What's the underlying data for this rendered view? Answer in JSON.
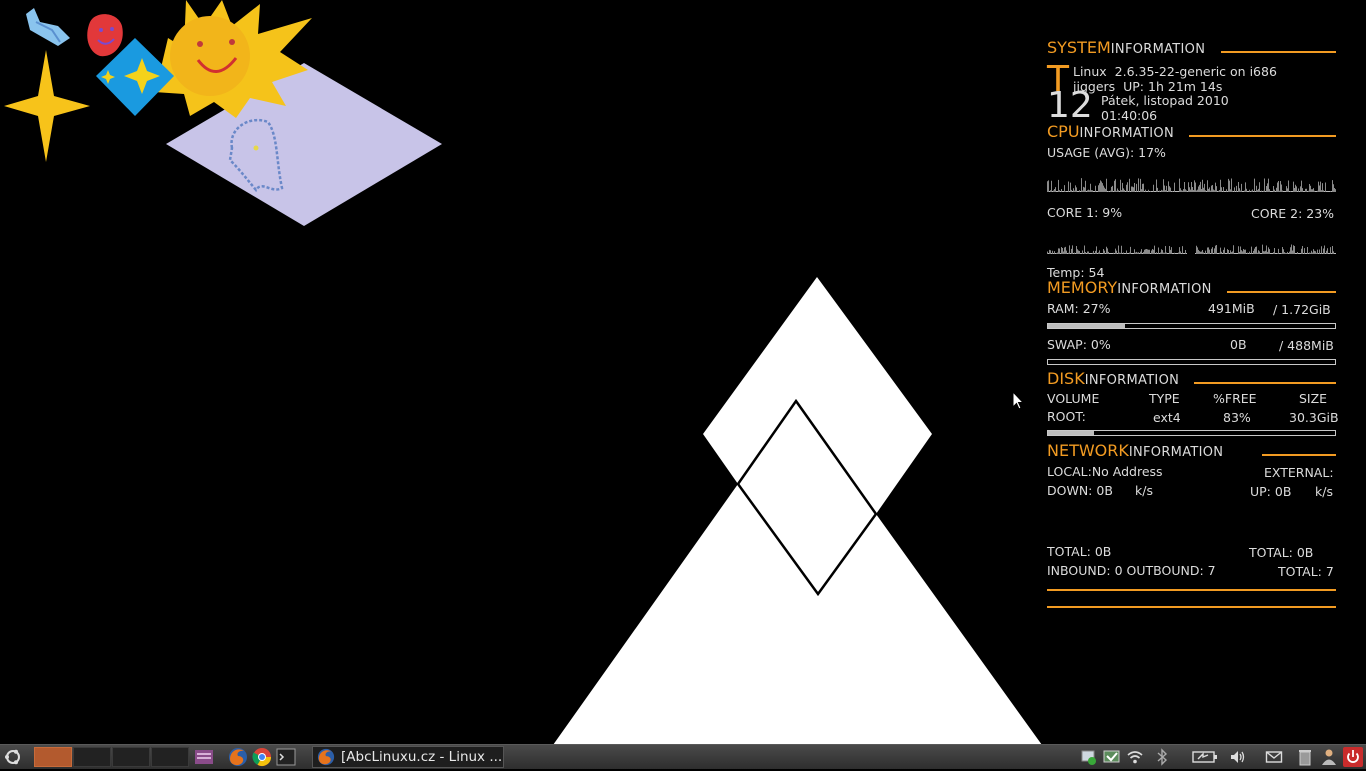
{
  "conky": {
    "system": {
      "title_big": "SYSTEM",
      "title_small": "INFORMATION",
      "letter": "T",
      "day": "12",
      "os": "Linux",
      "kernel": "2.6.35-22-generic on i686",
      "host": "jiggers",
      "uptime_label": "UP:",
      "uptime": "1h 21m 14s",
      "date": "Pátek, listopad 2010",
      "time": "01:40:06"
    },
    "cpu": {
      "title_big": "CPU",
      "title_small": "INFORMATION",
      "usage_label": "USAGE (AVG):",
      "usage": "17%",
      "core1_label": "CORE 1:",
      "core1": "9%",
      "core2_label": "CORE 2:",
      "core2": "23%",
      "temp_label": "Temp:",
      "temp": "54"
    },
    "memory": {
      "title_big": "MEMORY",
      "title_small": "INFORMATION",
      "ram_label": "RAM:",
      "ram_pct": "27%",
      "ram_used": "491MiB",
      "ram_total": "/ 1.72GiB",
      "ram_fraction": 0.27,
      "swap_label": "SWAP:",
      "swap_pct": "0%",
      "swap_used": "0B",
      "swap_total": "/ 488MiB",
      "swap_fraction": 0.0
    },
    "disk": {
      "title_big": "DISK",
      "title_small": "INFORMATION",
      "col_volume": "VOLUME",
      "col_type": "TYPE",
      "col_free": "%FREE",
      "col_size": "SIZE",
      "row_volume": "ROOT:",
      "row_type": "ext4",
      "row_free": "83%",
      "row_size": "30.3GiB",
      "used_fraction": 0.16
    },
    "network": {
      "title_big": "NETWORK",
      "title_small": "INFORMATION",
      "local_label": "LOCAL:",
      "local_value": "No Address",
      "external_label": "EXTERNAL:",
      "down_label": "DOWN:",
      "down_value": "0B",
      "down_unit": "k/s",
      "up_label": "UP:",
      "up_value": "0B",
      "up_unit": "k/s",
      "total_down_label": "TOTAL:",
      "total_down": "0B",
      "total_up_label": "TOTAL:",
      "total_up": "0B",
      "inbound_label": "INBOUND:",
      "inbound": "0",
      "outbound_label": "OUTBOUND:",
      "outbound": "7",
      "total_conn_label": "TOTAL:",
      "total_conn": "7"
    }
  },
  "taskbar": {
    "menu_icon": "ubuntu-logo-icon",
    "launchers": [
      "files-icon",
      "firefox-icon",
      "chrome-icon",
      "terminal-icon"
    ],
    "window_task": {
      "icon": "firefox-icon",
      "label": "[AbcLinuxu.cz - Linux ..."
    },
    "tray": [
      "network-manager-icon",
      "update-icon",
      "wifi-icon",
      "bluetooth-icon",
      "battery-icon",
      "volume-icon",
      "mail-icon",
      "trash-icon",
      "user-icon",
      "power-icon"
    ]
  },
  "colors": {
    "accent": "#f29b22",
    "background": "#000000",
    "text": "#dcdcdc"
  }
}
